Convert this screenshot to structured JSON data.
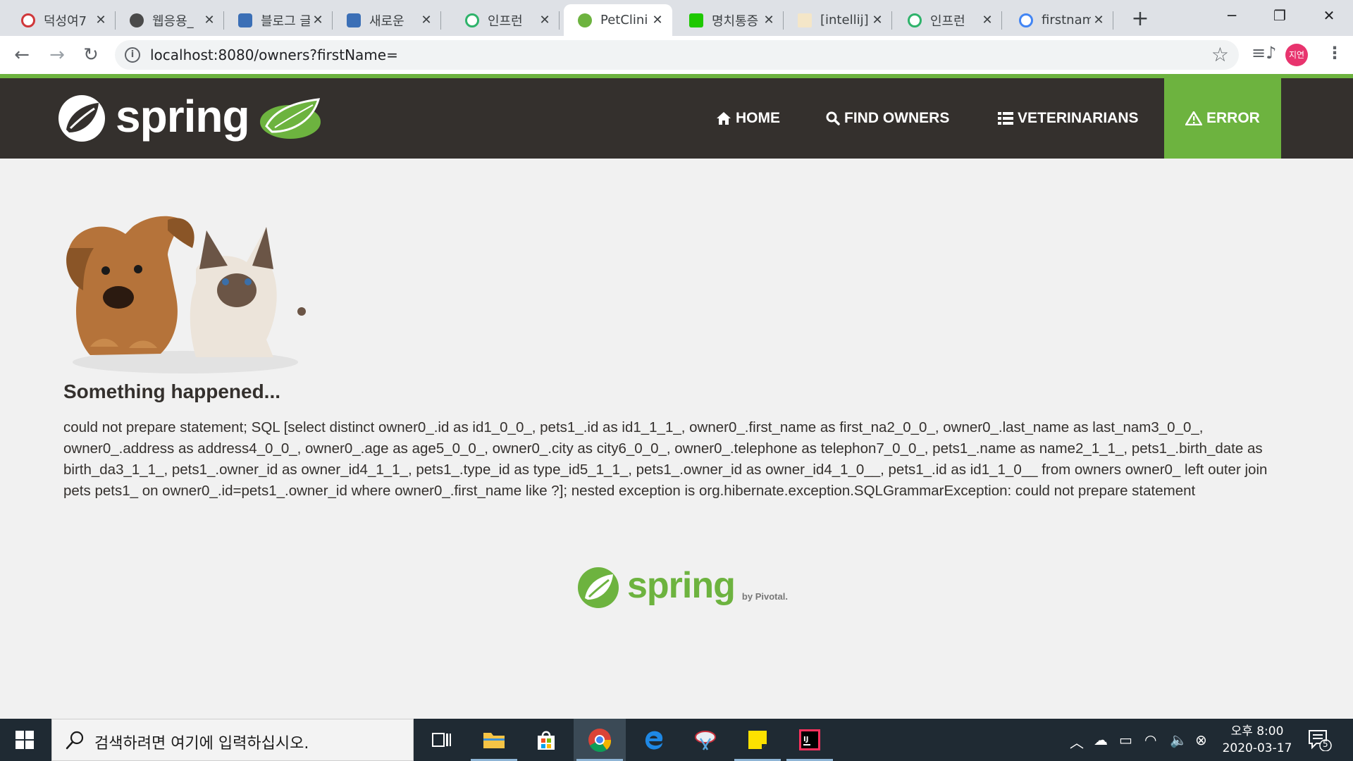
{
  "browser": {
    "tabs": [
      {
        "title": "덕성여7",
        "favicon_color": "#d0373a",
        "active": false
      },
      {
        "title": "웹응용_",
        "favicon_color": "#4a4a4a",
        "active": false
      },
      {
        "title": "블로그 글",
        "favicon_color": "#3b6fb6",
        "active": false
      },
      {
        "title": "새로운",
        "favicon_color": "#3b6fb6",
        "active": false
      },
      {
        "title": "인프런",
        "favicon_color": "#2fb36b",
        "active": false
      },
      {
        "title": "PetClini",
        "favicon_color": "#6db33f",
        "active": true
      },
      {
        "title": "명치통증",
        "favicon_color": "#1ec800",
        "active": false
      },
      {
        "title": "[intellij]",
        "favicon_color": "#f4e6c8",
        "active": false
      },
      {
        "title": "인프런",
        "favicon_color": "#2fb36b",
        "active": false
      },
      {
        "title": "firstnam",
        "favicon_color": "#4285f4",
        "active": false
      }
    ],
    "url": "localhost:8080/owners?firstName=",
    "profile_initials": "지연"
  },
  "navbar": {
    "brand": "spring",
    "items": [
      {
        "label": "HOME",
        "icon": "home-icon"
      },
      {
        "label": "FIND OWNERS",
        "icon": "search-icon"
      },
      {
        "label": "VETERINARIANS",
        "icon": "list-icon"
      },
      {
        "label": "ERROR",
        "icon": "warning-icon"
      }
    ]
  },
  "content": {
    "heading": "Something happened...",
    "message": "could not prepare statement; SQL [select distinct owner0_.id as id1_0_0_, pets1_.id as id1_1_1_, owner0_.first_name as first_na2_0_0_, owner0_.last_name as last_nam3_0_0_, owner0_.address as address4_0_0_, owner0_.age as age5_0_0_, owner0_.city as city6_0_0_, owner0_.telephone as telephon7_0_0_, pets1_.name as name2_1_1_, pets1_.birth_date as birth_da3_1_1_, pets1_.owner_id as owner_id4_1_1_, pets1_.type_id as type_id5_1_1_, pets1_.owner_id as owner_id4_1_0__, pets1_.id as id1_1_0__ from owners owner0_ left outer join pets pets1_ on owner0_.id=pets1_.owner_id where owner0_.first_name like ?]; nested exception is org.hibernate.exception.SQLGrammarException: could not prepare statement"
  },
  "footer": {
    "brand": "spring",
    "by": "by Pivotal."
  },
  "taskbar": {
    "search_placeholder": "검색하려면 여기에 입력하십시오.",
    "time": "오후 8:00",
    "date": "2020-03-17",
    "notification_count": "5"
  },
  "colors": {
    "spring_green": "#6db33f",
    "navbar_bg": "#34302d",
    "page_bg": "#f1f1f1"
  }
}
